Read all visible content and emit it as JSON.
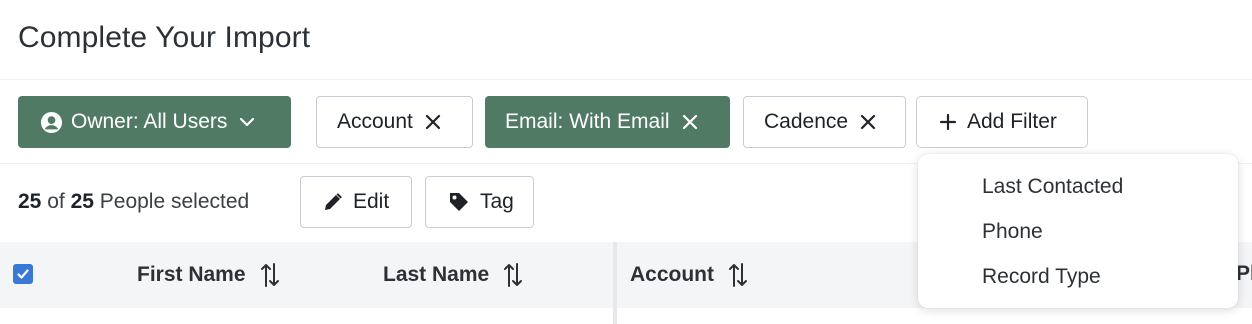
{
  "header": {
    "title": "Complete Your Import"
  },
  "filters": {
    "owner": {
      "label": "Owner: All Users",
      "icon": "user-circle-icon",
      "color": "#517a65"
    },
    "account": {
      "label": "Account"
    },
    "email": {
      "label": "Email: With Email",
      "color": "#517a65"
    },
    "cadence": {
      "label": "Cadence"
    },
    "add_filter": {
      "label": "Add Filter"
    }
  },
  "selection": {
    "selected_count": "25",
    "of": "of",
    "total_count": "25",
    "suffix": "People selected",
    "edit_label": "Edit",
    "tag_label": "Tag"
  },
  "table": {
    "select_all_checked": true,
    "columns": [
      "First Name",
      "Last Name",
      "Account",
      "Ph"
    ]
  },
  "add_filter_menu": {
    "items": [
      "Last Contacted",
      "Phone",
      "Record Type"
    ]
  }
}
